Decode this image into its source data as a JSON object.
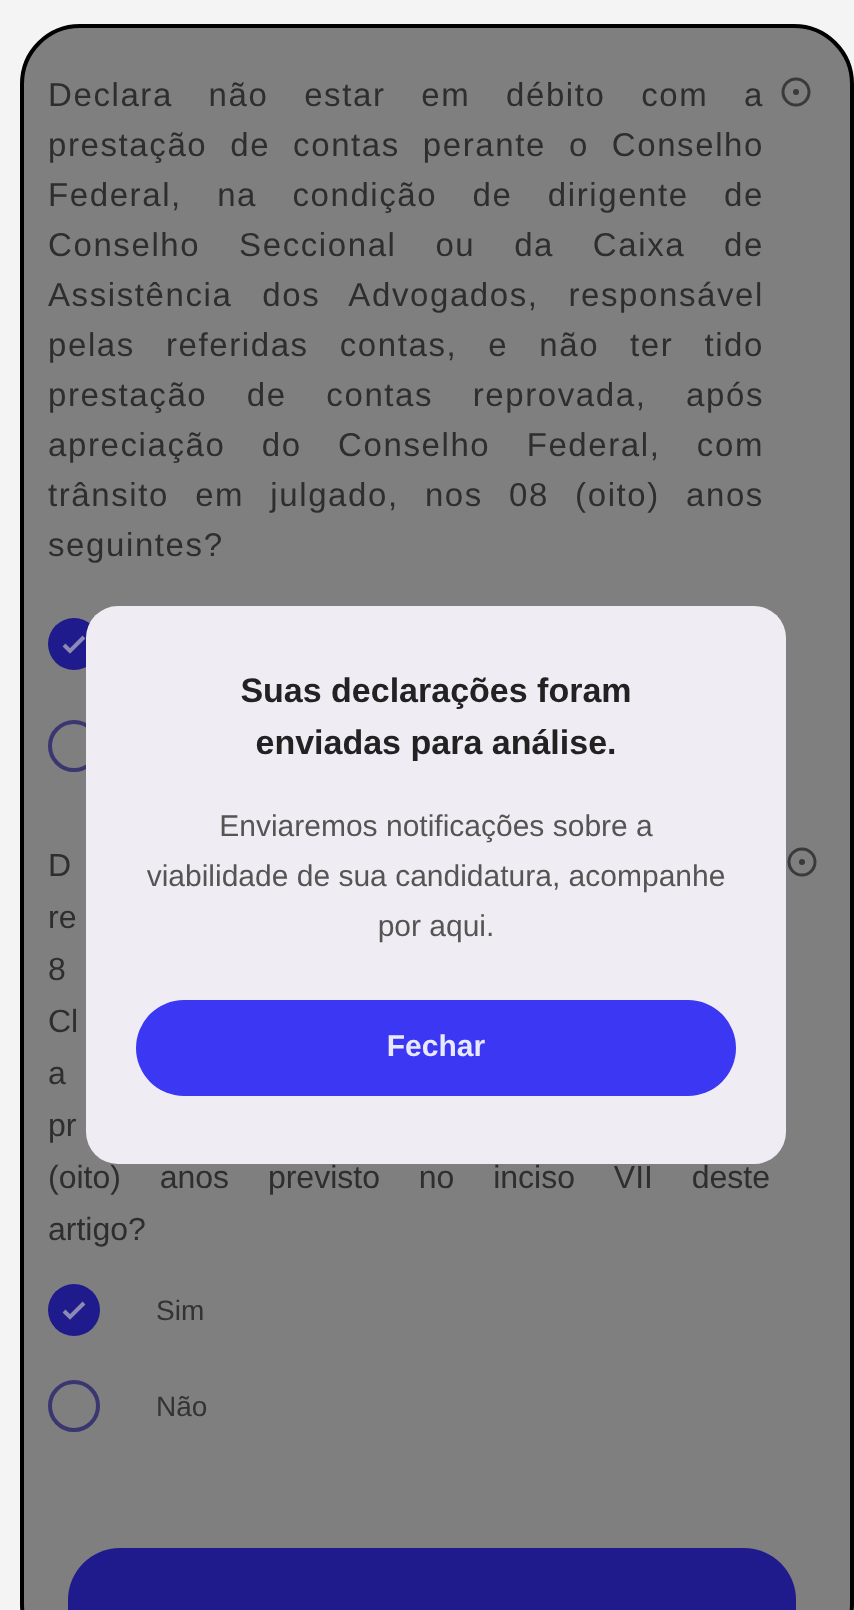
{
  "questions": [
    {
      "text": [
        "Declara não estar em débito com a prestação de contas perante o Conselho Federal, na condição de dirigente de Conselho Seccional ou da Caixa de Assistência dos Advogados, responsável pelas referidas contas, e não ter tido prestação de contas reprovada, após apreciação do Conselho Federal, com trânsito em julgado, nos 08 (oito) anos seguintes?"
      ],
      "options": [
        {
          "selected": true
        },
        {
          "selected": false
        }
      ]
    },
    {
      "text": [
        "D",
        "re",
        "8",
        "Cl",
        "a",
        "pr",
        "(oito) anos previsto no inciso VII deste",
        "artigo?"
      ],
      "options": [
        {
          "label": "Sim",
          "selected": true
        },
        {
          "label": "Não",
          "selected": false
        }
      ]
    }
  ],
  "dialog": {
    "title": "Suas declarações foram enviadas para análise.",
    "message": "Enviaremos notificações sobre a viabilidade de sua candidatura, acompanhe por aqui.",
    "button": "Fechar"
  }
}
